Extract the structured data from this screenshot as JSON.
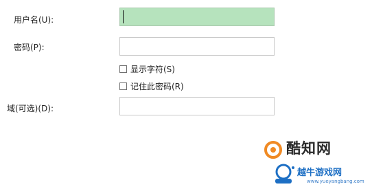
{
  "form": {
    "username_label": "用户名(U):",
    "username_value": "",
    "password_label": "密码(P):",
    "password_value": "",
    "show_chars_label": "显示字符(S)",
    "show_chars_checked": false,
    "remember_label": "记住此密码(R)",
    "remember_checked": false,
    "domain_label": "域(可选)(D):",
    "domain_value": ""
  },
  "watermark": {
    "brand": "酷知网",
    "site": "越牛游戏网",
    "url": "www.yueyangbang.com"
  },
  "colors": {
    "active_field": "#b6e3bd",
    "field_border": "#c9c9c9",
    "watermark_orange": "#f08a24",
    "watermark_blue": "#1d6fc4"
  }
}
